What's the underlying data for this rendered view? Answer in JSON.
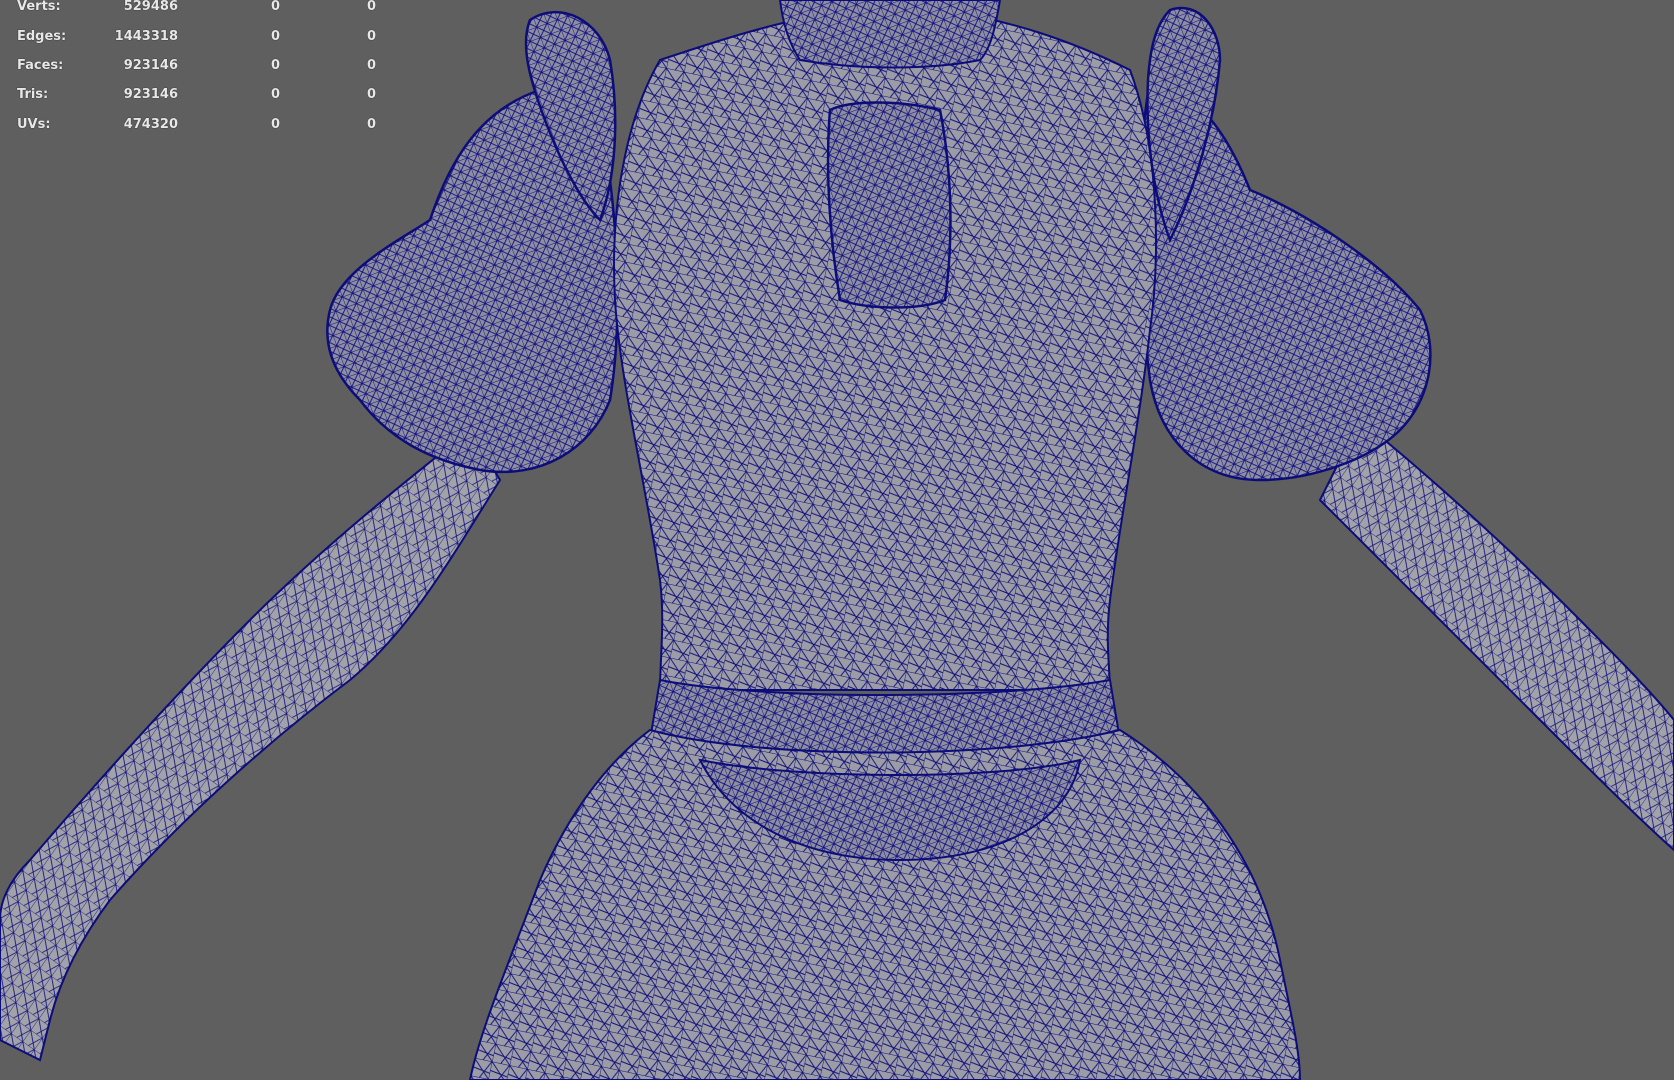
{
  "viewport": {
    "background_color": "#5f5f5f",
    "mesh_fill_color": "#9a9aa4",
    "wire_color": "#0d0d7a",
    "display_mode": "wireframe-on-shaded"
  },
  "poly_count_hud": {
    "rows": [
      {
        "label": "Verts:",
        "values": [
          "529486",
          "0",
          "0"
        ]
      },
      {
        "label": "Edges:",
        "values": [
          "1443318",
          "0",
          "0"
        ]
      },
      {
        "label": "Faces:",
        "values": [
          "923146",
          "0",
          "0"
        ]
      },
      {
        "label": "Tris:",
        "values": [
          "923146",
          "0",
          "0"
        ]
      },
      {
        "label": "UVs:",
        "values": [
          "474320",
          "0",
          "0"
        ]
      }
    ]
  }
}
